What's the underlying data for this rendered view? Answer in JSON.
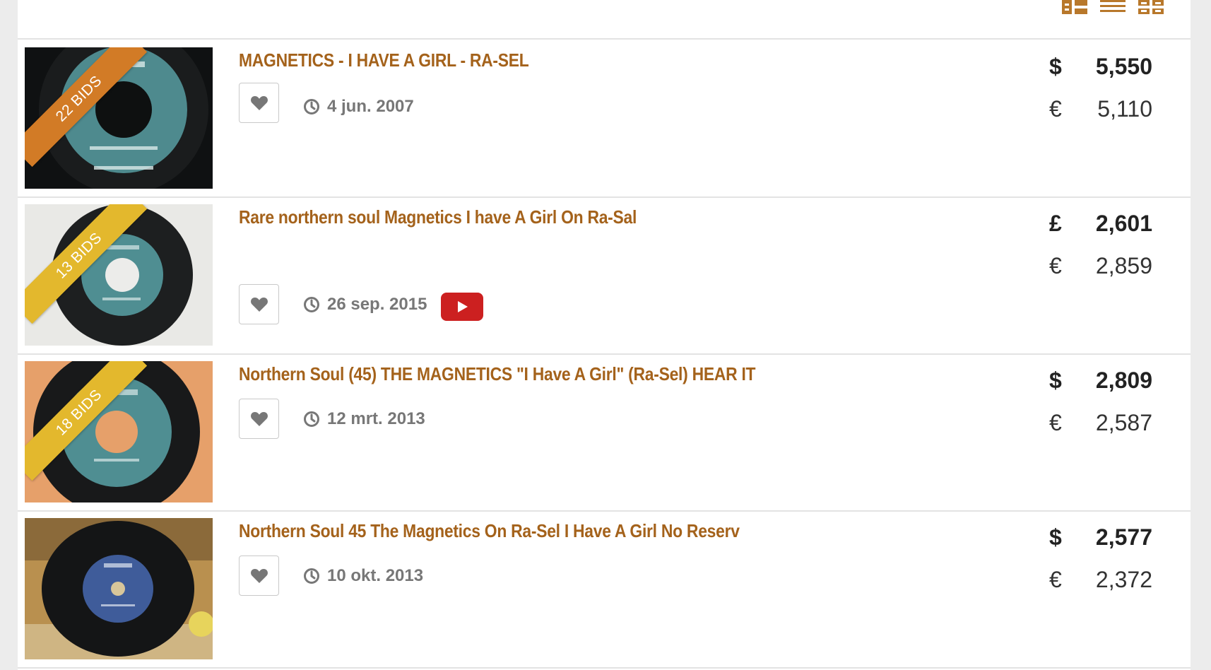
{
  "toolbar": {
    "views": [
      {
        "name": "detail-view-icon"
      },
      {
        "name": "list-view-icon"
      },
      {
        "name": "grid-view-icon"
      }
    ]
  },
  "colors": {
    "title": "#a4621b",
    "ribbon_orange": "#d27b26",
    "ribbon_yellow": "#e3b82d",
    "youtube_red": "#cc2020"
  },
  "listings": [
    {
      "bids": "22 BIDS",
      "title": "MAGNETICS - I HAVE A GIRL - RA-SEL",
      "date": "4 jun. 2007",
      "price_primary_symbol": "$",
      "price_primary": "5,550",
      "price_secondary_symbol": "€",
      "price_secondary": "5,110",
      "has_video": false
    },
    {
      "bids": "13 BIDS",
      "title": "Rare northern soul Magnetics I have A Girl On Ra-Sal",
      "date": "26 sep. 2015",
      "price_primary_symbol": "£",
      "price_primary": "2,601",
      "price_secondary_symbol": "€",
      "price_secondary": "2,859",
      "has_video": true
    },
    {
      "bids": "18 BIDS",
      "title": "Northern Soul (45) THE MAGNETICS \"I Have A Girl\" (Ra-Sel) HEAR IT",
      "date": "12 mrt. 2013",
      "price_primary_symbol": "$",
      "price_primary": "2,809",
      "price_secondary_symbol": "€",
      "price_secondary": "2,587",
      "has_video": false
    },
    {
      "bids": "",
      "title": "Northern Soul 45 The Magnetics On Ra-Sel I Have A Girl No Reserv",
      "date": "10 okt. 2013",
      "price_primary_symbol": "$",
      "price_primary": "2,577",
      "price_secondary_symbol": "€",
      "price_secondary": "2,372",
      "has_video": false
    }
  ]
}
